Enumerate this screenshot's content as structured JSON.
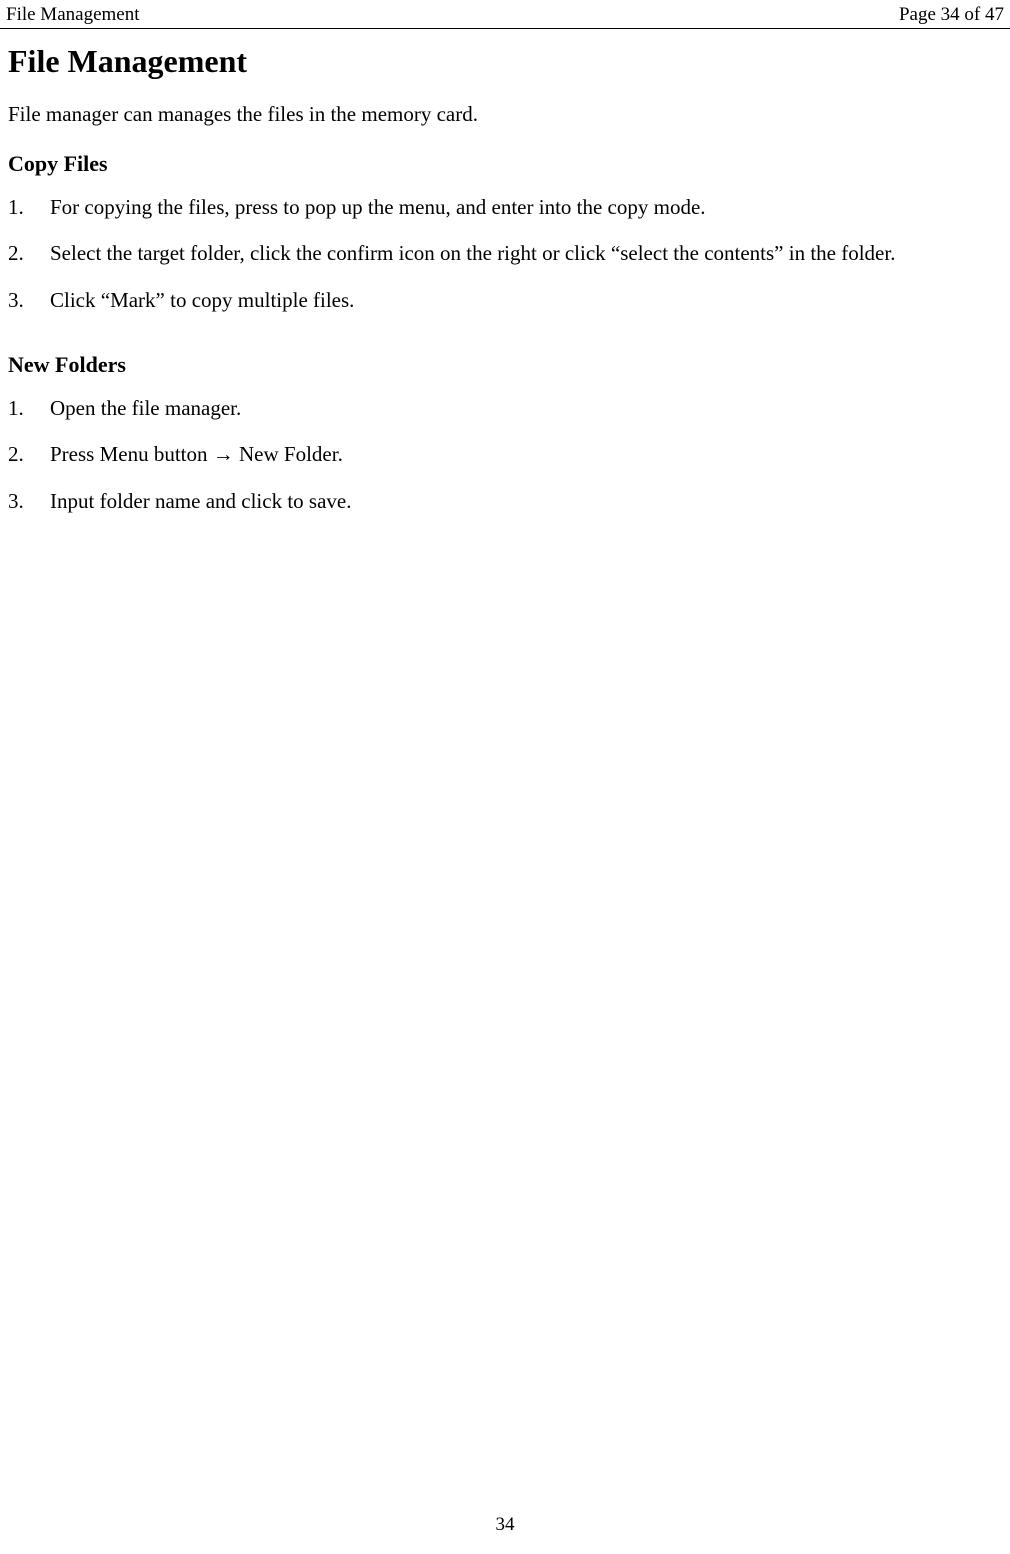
{
  "header": {
    "left": "File Management",
    "right": "Page 34 of 47"
  },
  "title": "File Management",
  "intro": "File manager can manages the files in the memory card.",
  "sections": [
    {
      "heading": "Copy Files",
      "items": [
        "For copying the files, press to pop up the menu, and enter into the copy mode.",
        "Select the target folder, click the confirm icon on the right or click “select the contents” in the folder.",
        "Click “Mark” to copy multiple files."
      ]
    },
    {
      "heading": "New Folders",
      "items": [
        "Open the file manager.",
        "Press Menu button → New Folder.",
        "Input folder name and click to save."
      ]
    }
  ],
  "footer": {
    "page_number": "34"
  }
}
